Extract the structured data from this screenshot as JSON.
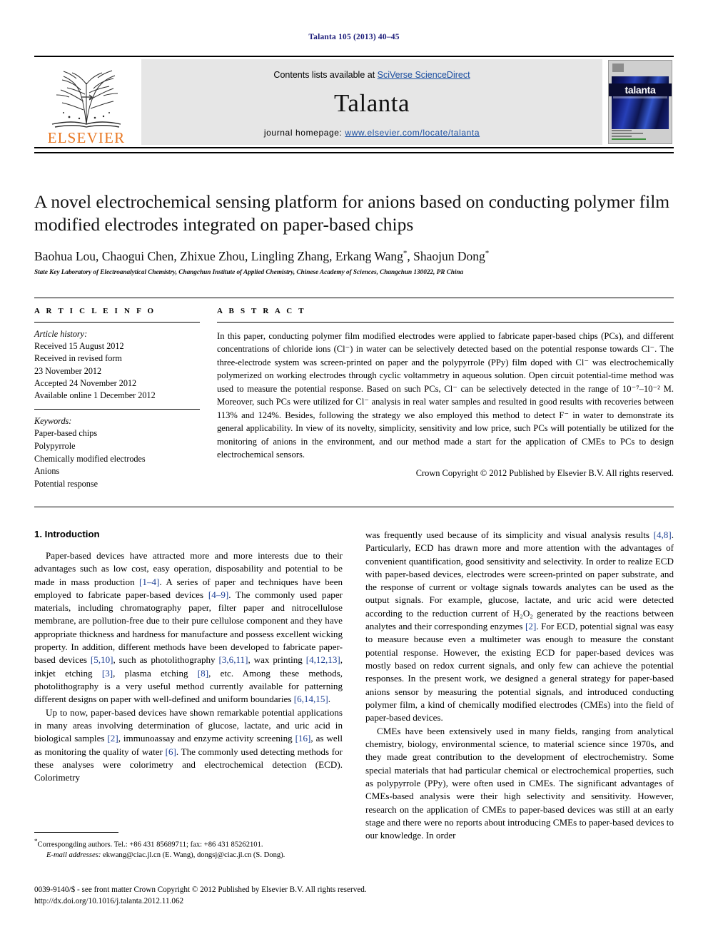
{
  "running_head": "Talanta 105 (2013) 40–45",
  "masthead": {
    "publisher": "ELSEVIER",
    "contents_prefix": "Contents lists available at ",
    "contents_link": "SciVerse ScienceDirect",
    "journal_name": "Talanta",
    "homepage_prefix": "journal homepage: ",
    "homepage_link": "www.elsevier.com/locate/talanta",
    "cover_title": "talanta"
  },
  "article": {
    "title": "A novel electrochemical sensing platform for anions based on conducting polymer film modified electrodes integrated on paper-based chips",
    "authors": "Baohua Lou, Chaogui Chen, Zhixue Zhou, Lingling Zhang, Erkang Wang",
    "authors_tail": ", Shaojun Dong",
    "affiliation": "State Key Laboratory of Electroanalytical Chemistry, Changchun Institute of Applied Chemistry, Chinese Academy of Sciences, Changchun 130022, PR China"
  },
  "info": {
    "heading": "A R T I C L E   I N F O",
    "history_label": "Article history:",
    "history": [
      "Received 15 August 2012",
      "Received in revised form",
      "23 November 2012",
      "Accepted 24 November 2012",
      "Available online 1 December 2012"
    ],
    "keywords_label": "Keywords:",
    "keywords": [
      "Paper-based chips",
      "Polypyrrole",
      "Chemically modified electrodes",
      "Anions",
      "Potential response"
    ]
  },
  "abstract": {
    "heading": "A B S T R A C T",
    "text": "In this paper, conducting polymer film modified electrodes were applied to fabricate paper-based chips (PCs), and different concentrations of chloride ions (Cl⁻) in water can be selectively detected based on the potential response towards Cl⁻. The three-electrode system was screen-printed on paper and the polypyrrole (PPy) film doped with Cl⁻ was electrochemically polymerized on working electrodes through cyclic voltammetry in aqueous solution. Open circuit potential-time method was used to measure the potential response. Based on such PCs, Cl⁻ can be selectively detected in the range of 10⁻⁷–10⁻² M. Moreover, such PCs were utilized for Cl⁻ analysis in real water samples and resulted in good results with recoveries between 113% and 124%. Besides, following the strategy we also employed this method to detect F⁻ in water to demonstrate its general applicability. In view of its novelty, simplicity, sensitivity and low price, such PCs will potentially be utilized for the monitoring of anions in the environment, and our method made a start for the application of CMEs to PCs to design electrochemical sensors.",
    "copyright": "Crown Copyright © 2012 Published by Elsevier B.V. All rights reserved."
  },
  "body": {
    "section_heading": "1.  Introduction",
    "left_paragraphs": [
      "Paper-based devices have attracted more and more interests due to their advantages such as low cost, easy operation, disposability and potential to be made in mass production [1–4]. A series of paper and techniques have been employed to fabricate paper-based devices [4–9]. The commonly used paper materials, including chromatography paper, filter paper and nitrocellulose membrane, are pollution-free due to their pure cellulose component and they have appropriate thickness and hardness for manufacture and possess excellent wicking property. In addition, different methods have been developed to fabricate paper-based devices [5,10], such as photolithography [3,6,11], wax printing [4,12,13], inkjet etching [3], plasma etching [8], etc. Among these methods, photolithography is a very useful method currently available for patterning different designs on paper with well-defined and uniform boundaries [6,14,15].",
      "Up to now, paper-based devices have shown remarkable potential applications in many areas involving determination of glucose, lactate, and uric acid in biological samples [2], immunoassay and enzyme activity screening [16], as well as monitoring the quality of water [6]. The commonly used detecting methods for these analyses were colorimetry and electrochemical detection (ECD). Colorimetry"
    ],
    "right_paragraphs": [
      "was frequently used because of its simplicity and visual analysis results [4,8]. Particularly, ECD has drawn more and more attention with the advantages of convenient quantification, good sensitivity and selectivity. In order to realize ECD with paper-based devices, electrodes were screen-printed on paper substrate, and the response of current or voltage signals towards analytes can be used as the output signals. For example, glucose, lactate, and uric acid were detected according to the reduction current of H₂O₂ generated by the reactions between analytes and their corresponding enzymes [2]. For ECD, potential signal was easy to measure because even a multimeter was enough to measure the constant potential response. However, the existing ECD for paper-based devices was mostly based on redox current signals, and only few can achieve the potential responses. In the present work, we designed a general strategy for paper-based anions sensor by measuring the potential signals, and introduced conducting polymer film, a kind of chemically modified electrodes (CMEs) into the field of paper-based devices.",
      "CMEs have been extensively used in many fields, ranging from analytical chemistry, biology, environmental science, to material science since 1970s, and they made great contribution to the development of electrochemistry. Some special materials that had particular chemical or electrochemical properties, such as polypyrrole (PPy), were often used in CMEs. The significant advantages of CMEs-based analysis were their high selectivity and sensitivity. However, research on the application of CMEs to paper-based devices was still at an early stage and there were no reports about introducing CMEs to paper-based devices to our knowledge. In order"
    ]
  },
  "footnotes": {
    "corresponding": "Correspongding authors. Tel.: +86 431 85689711; fax: +86 431 85262101.",
    "email_label": "E-mail addresses:",
    "emails": " ekwang@ciac.jl.cn (E. Wang), dongsj@ciac.jl.cn (S. Dong)."
  },
  "bottom": {
    "issn_line": "0039-9140/$ - see front matter Crown Copyright © 2012 Published by Elsevier B.V. All rights reserved.",
    "doi_line": "http://dx.doi.org/10.1016/j.talanta.2012.11.062"
  },
  "colors": {
    "running_head": "#1c1c7a",
    "link": "#1b4ea0",
    "citation": "#1c3f94",
    "elsevier_orange": "#e87722",
    "masthead_bg": "#e6e6e6"
  }
}
